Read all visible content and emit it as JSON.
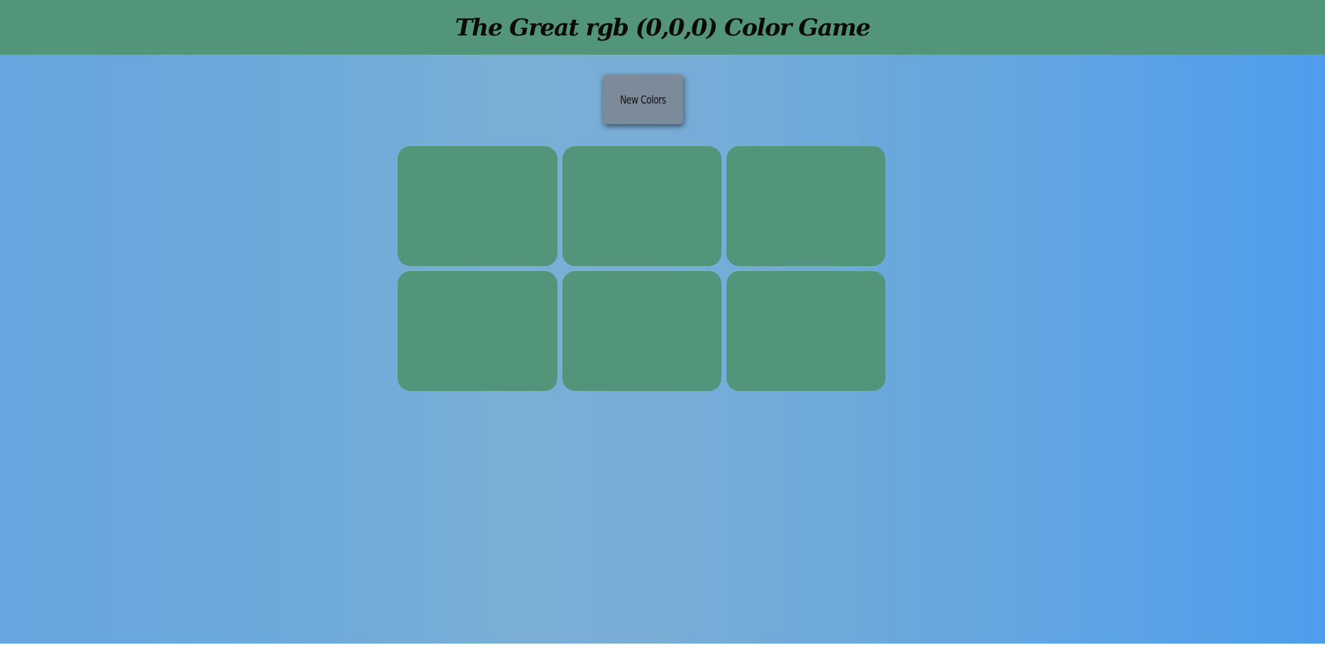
{
  "header": {
    "title": "The Great rgb (0,0,0) Color Game",
    "background": "#52957b"
  },
  "controls": {
    "new_colors_label": "New Colors",
    "button_color": "#7d8a9a"
  },
  "squares": {
    "count": 6,
    "color": "#52957b"
  },
  "page": {
    "background_gradient": [
      "#67a5e0",
      "#7aaed5",
      "#4f9ced"
    ]
  }
}
